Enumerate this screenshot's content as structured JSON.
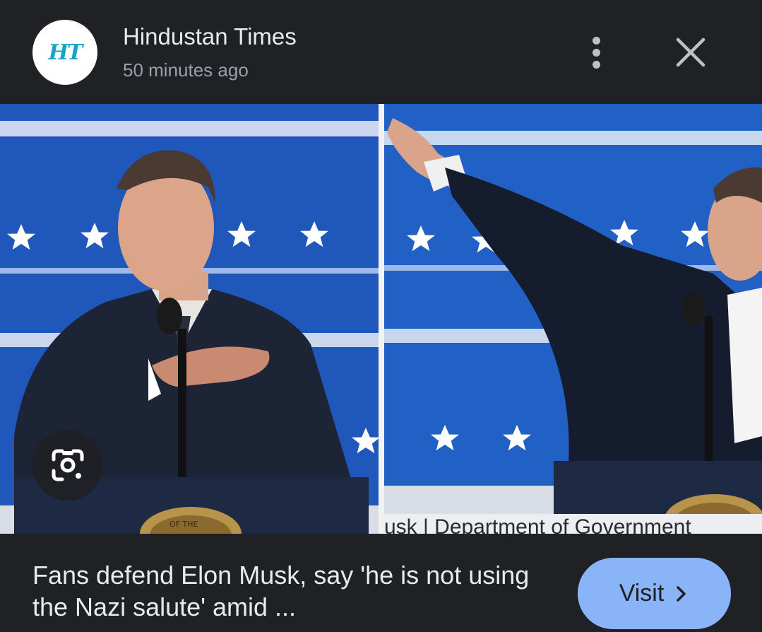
{
  "header": {
    "logo_text": "HT",
    "source_name": "Hindustan Times",
    "timestamp": "50 minutes ago"
  },
  "image": {
    "caption_text": "usk | Department of Government",
    "seal_text": "OF THE"
  },
  "footer": {
    "headline": "Fans defend Elon Musk, say 'he is not using the Nazi salute' amid ...",
    "visit_label": "Visit"
  },
  "icons": {
    "more": "more-vert-icon",
    "close": "close-icon",
    "lens": "google-lens-icon",
    "chevron": "chevron-right-icon"
  },
  "colors": {
    "background": "#202124",
    "accent_button": "#8ab4f8",
    "logo_brand": "#19a3c4"
  }
}
